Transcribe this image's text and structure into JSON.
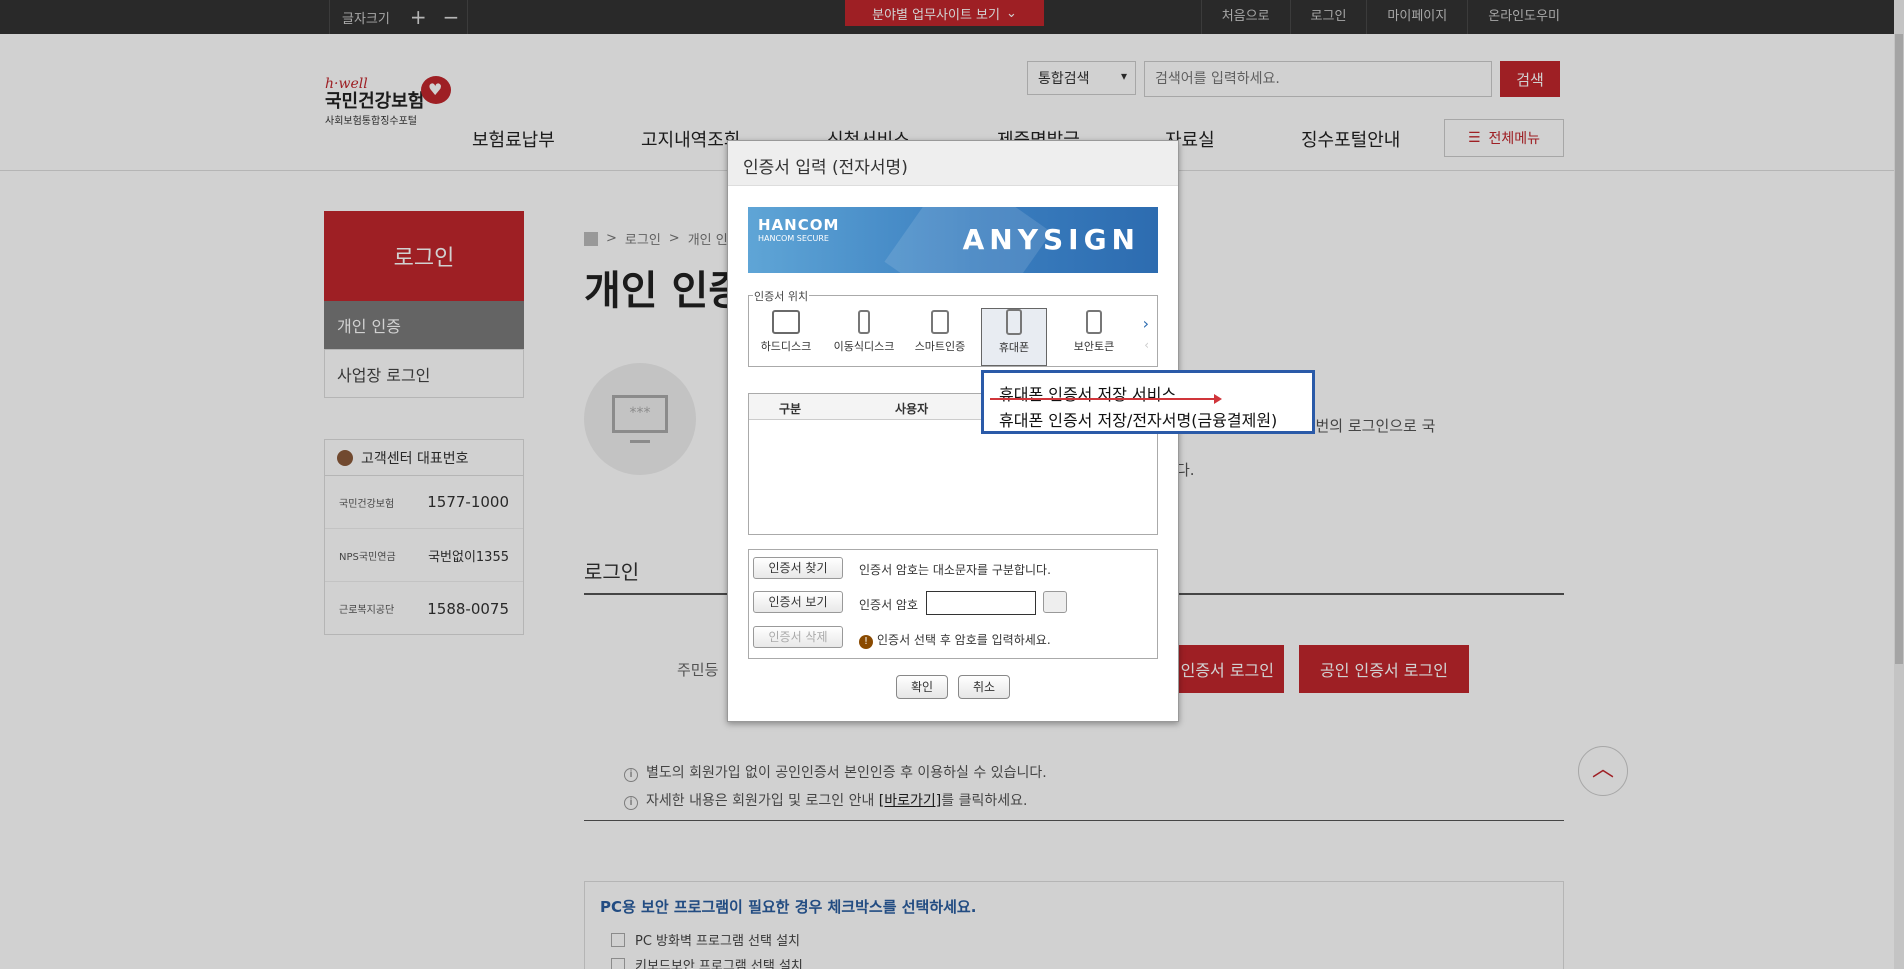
{
  "topbar": {
    "font_size_label": "글자크기",
    "plus": "+",
    "minus": "−",
    "sites_label": "분야별 업무사이트 보기",
    "links": [
      "처음으로",
      "로그인",
      "마이페이지",
      "온라인도우미"
    ]
  },
  "logo": {
    "brand": "h·well",
    "name": "국민건강보험",
    "sub": "사회보험통합징수포털"
  },
  "search": {
    "scope": "통합검색",
    "placeholder": "검색어를 입력하세요.",
    "button": "검색"
  },
  "gnb": {
    "items": [
      "보험료납부",
      "고지내역조회",
      "신청서비스",
      "제증명발급",
      "자료실",
      "징수포털안내"
    ],
    "all_menu": "전체메뉴"
  },
  "sidebar": {
    "title": "로그인",
    "items": [
      "개인 인증",
      "사업장 로그인"
    ],
    "cs_title": "고객센터 대표번호",
    "cs_rows": [
      {
        "org": "국민건강보험",
        "num": "1577-1000"
      },
      {
        "org": "NPS국민연금",
        "num": "국번없이1355"
      },
      {
        "org": "근로복지공단",
        "num": "1588-0075"
      }
    ]
  },
  "main": {
    "breadcrumb": [
      "로그인",
      "개인 인"
    ],
    "title": "개인 인증",
    "intro_line1": "용하실 수 있으며, 한번의 로그인으로 국",
    "intro_line2": "다.",
    "login_head": "로그인",
    "jumin_label": "주민등",
    "btn_mobile": "인증서 로그인",
    "btn_public": "공인 인증서 로그인",
    "note1": "별도의 회원가입 없이 공인인증서 본인인증 후 이용하실 수 있습니다.",
    "note2_pre": "자세한 내용은 회원가입 및 로그인 안내 ",
    "note2_link": "[바로가기]",
    "note2_post": "를 클릭하세요.",
    "pc_title": "PC용 보안 프로그램이 필요한 경우 체크박스를 선택하세요.",
    "pc_items": [
      "PC 방화벽 프로그램 선택 설치",
      "키보드보안 프로그램 선택 설치"
    ]
  },
  "dialog": {
    "title": "인증서 입력 (전자서명)",
    "banner_hancom": "HANCOM",
    "banner_sub": "HANCOM SECURE",
    "banner_product": "ANYSIGN",
    "location_legend": "인증서 위치",
    "locations": [
      "하드디스크",
      "이동식디스크",
      "스마트인증",
      "휴대폰",
      "보안토큰"
    ],
    "table_headers": [
      "구분",
      "사용자"
    ],
    "btn_find": "인증서 찾기",
    "btn_view": "인증서 보기",
    "btn_delete": "인증서 삭제",
    "case_note": "인증서 암호는 대소문자를 구분합니다.",
    "pw_label": "인증서 암호",
    "pw_hint": "인증서 선택 후 암호를 입력하세요.",
    "ok": "확인",
    "cancel": "취소"
  },
  "popup": {
    "option1": "휴대폰 인증서 저장 서비스",
    "option2": "휴대폰 인증서 저장/전자서명(금융결제원)"
  },
  "colors": {
    "brand_red": "#c1272d",
    "popup_border": "#2a5aa8",
    "banner_blue": "#3b7fc0"
  }
}
